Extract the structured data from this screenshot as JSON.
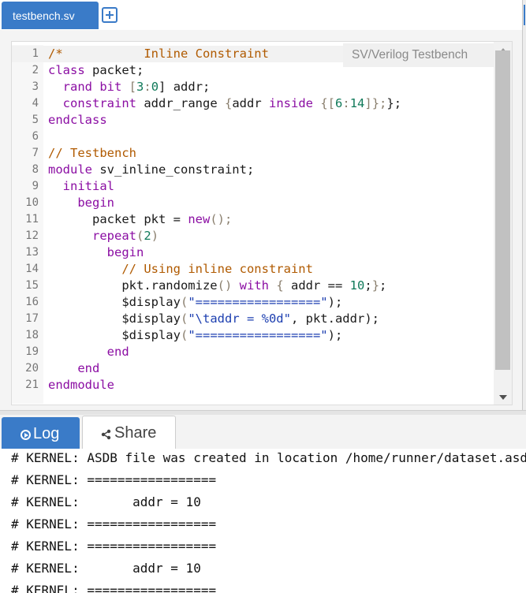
{
  "editor": {
    "tab_label": "testbench.sv",
    "language_label": "SV/Verilog Testbench",
    "lines": [
      [
        {
          "t": "/*",
          "c": "comment"
        },
        {
          "t": "           Inline Constraint",
          "c": "comment"
        }
      ],
      [
        {
          "t": "class",
          "c": "keyword"
        },
        {
          "t": " packet;",
          "c": "plain"
        }
      ],
      [
        {
          "t": "  ",
          "c": "plain"
        },
        {
          "t": "rand",
          "c": "keyword"
        },
        {
          "t": " ",
          "c": "plain"
        },
        {
          "t": "bit",
          "c": "keyword"
        },
        {
          "t": " [",
          "c": "punct"
        },
        {
          "t": "3",
          "c": "num"
        },
        {
          "t": ":",
          "c": "punct"
        },
        {
          "t": "0",
          "c": "num"
        },
        {
          "t": "] addr;",
          "c": "plain"
        }
      ],
      [
        {
          "t": "  ",
          "c": "plain"
        },
        {
          "t": "constraint",
          "c": "keyword"
        },
        {
          "t": " addr_range ",
          "c": "plain"
        },
        {
          "t": "{",
          "c": "punct"
        },
        {
          "t": "addr ",
          "c": "plain"
        },
        {
          "t": "inside",
          "c": "keyword"
        },
        {
          "t": " {[",
          "c": "punct"
        },
        {
          "t": "6",
          "c": "num"
        },
        {
          "t": ":",
          "c": "punct"
        },
        {
          "t": "14",
          "c": "num"
        },
        {
          "t": "]};",
          "c": "punct"
        },
        {
          "t": "};",
          "c": "plain"
        }
      ],
      [
        {
          "t": "endclass",
          "c": "keyword"
        }
      ],
      [
        {
          "t": "",
          "c": "plain"
        }
      ],
      [
        {
          "t": "// Testbench",
          "c": "comment"
        }
      ],
      [
        {
          "t": "module",
          "c": "keyword"
        },
        {
          "t": " sv_inline_constraint;",
          "c": "plain"
        }
      ],
      [
        {
          "t": "  ",
          "c": "plain"
        },
        {
          "t": "initial",
          "c": "keyword"
        }
      ],
      [
        {
          "t": "    ",
          "c": "plain"
        },
        {
          "t": "begin",
          "c": "keyword"
        }
      ],
      [
        {
          "t": "      packet pkt = ",
          "c": "plain"
        },
        {
          "t": "new",
          "c": "keyword"
        },
        {
          "t": "();",
          "c": "punct"
        }
      ],
      [
        {
          "t": "      ",
          "c": "plain"
        },
        {
          "t": "repeat",
          "c": "keyword"
        },
        {
          "t": "(",
          "c": "punct"
        },
        {
          "t": "2",
          "c": "num"
        },
        {
          "t": ")",
          "c": "punct"
        }
      ],
      [
        {
          "t": "        ",
          "c": "plain"
        },
        {
          "t": "begin",
          "c": "keyword"
        }
      ],
      [
        {
          "t": "          ",
          "c": "plain"
        },
        {
          "t": "// Using inline constraint",
          "c": "comment"
        }
      ],
      [
        {
          "t": "          pkt.randomize",
          "c": "plain"
        },
        {
          "t": "()",
          "c": "punct"
        },
        {
          "t": " ",
          "c": "plain"
        },
        {
          "t": "with",
          "c": "keyword"
        },
        {
          "t": " ",
          "c": "plain"
        },
        {
          "t": "{",
          "c": "punct"
        },
        {
          "t": " addr == ",
          "c": "plain"
        },
        {
          "t": "10",
          "c": "num"
        },
        {
          "t": ";",
          "c": "plain"
        },
        {
          "t": "}",
          "c": "punct"
        },
        {
          "t": ";",
          "c": "plain"
        }
      ],
      [
        {
          "t": "          $display",
          "c": "plain"
        },
        {
          "t": "(",
          "c": "punct"
        },
        {
          "t": "\"=================\"",
          "c": "string"
        },
        {
          "t": ");",
          "c": "plain"
        }
      ],
      [
        {
          "t": "          $display",
          "c": "plain"
        },
        {
          "t": "(",
          "c": "punct"
        },
        {
          "t": "\"\\taddr = %0d\"",
          "c": "string"
        },
        {
          "t": ", pkt.addr",
          "c": "plain"
        },
        {
          "t": ");",
          "c": "plain"
        }
      ],
      [
        {
          "t": "          $display",
          "c": "plain"
        },
        {
          "t": "(",
          "c": "punct"
        },
        {
          "t": "\"=================\"",
          "c": "string"
        },
        {
          "t": ");",
          "c": "plain"
        }
      ],
      [
        {
          "t": "        ",
          "c": "plain"
        },
        {
          "t": "end",
          "c": "keyword"
        }
      ],
      [
        {
          "t": "    ",
          "c": "plain"
        },
        {
          "t": "end",
          "c": "keyword"
        }
      ],
      [
        {
          "t": "endmodule",
          "c": "keyword"
        }
      ]
    ]
  },
  "bottom": {
    "log_tab": "Log",
    "share_tab": "Share",
    "log_lines": [
      "# KERNEL: ASDB file was created in location /home/runner/dataset.asdb",
      "# KERNEL: =================",
      "# KERNEL:       addr = 10",
      "# KERNEL: =================",
      "# KERNEL: =================",
      "# KERNEL:       addr = 10",
      "# KERNEL: ================="
    ]
  },
  "colors": {
    "accent": "#3a7bc8",
    "keyword": "#8b0ea3",
    "comment": "#b05a00",
    "string": "#1d3fb0",
    "number": "#117a5a"
  },
  "icons": [
    "plus-icon",
    "scroll-up-arrow-icon",
    "scroll-down-arrow-icon",
    "play-circle-icon",
    "share-icon"
  ]
}
